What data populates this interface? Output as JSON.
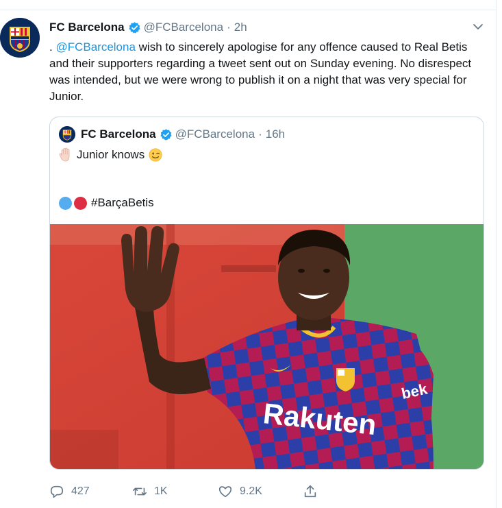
{
  "tweet": {
    "author_name": "FC Barcelona",
    "handle": "@FCBarcelona",
    "separator": "·",
    "time": "2h",
    "text_prefix": ". ",
    "mention": "@FCBarcelona",
    "text_body": " wish to sincerely apologise for any offence caused to Real Betis and their supporters regarding a tweet sent out on Sunday evening. No disrespect was intended, but we were wrong to publish it on a night that was very special for Junior."
  },
  "quoted_tweet": {
    "author_name": "FC Barcelona",
    "handle": "@FCBarcelona",
    "separator": "·",
    "time": "16h",
    "line1_text": "Junior knows",
    "line1_icons": [
      "raised-hand-emoji",
      "winking-face-emoji"
    ],
    "line2_text": "#BarçaBetis",
    "line2_icons": [
      "blue-circle-emoji",
      "red-circle-emoji"
    ],
    "image": "photo of player in Barcelona kit waving"
  },
  "actions": {
    "reply_count": "427",
    "retweet_count": "1K",
    "like_count": "9.2K",
    "share_icon": "share-icon"
  },
  "colors": {
    "link": "#1b95e0",
    "muted": "#657786",
    "verified": "#1da1f2",
    "border": "#ccd6dd"
  }
}
